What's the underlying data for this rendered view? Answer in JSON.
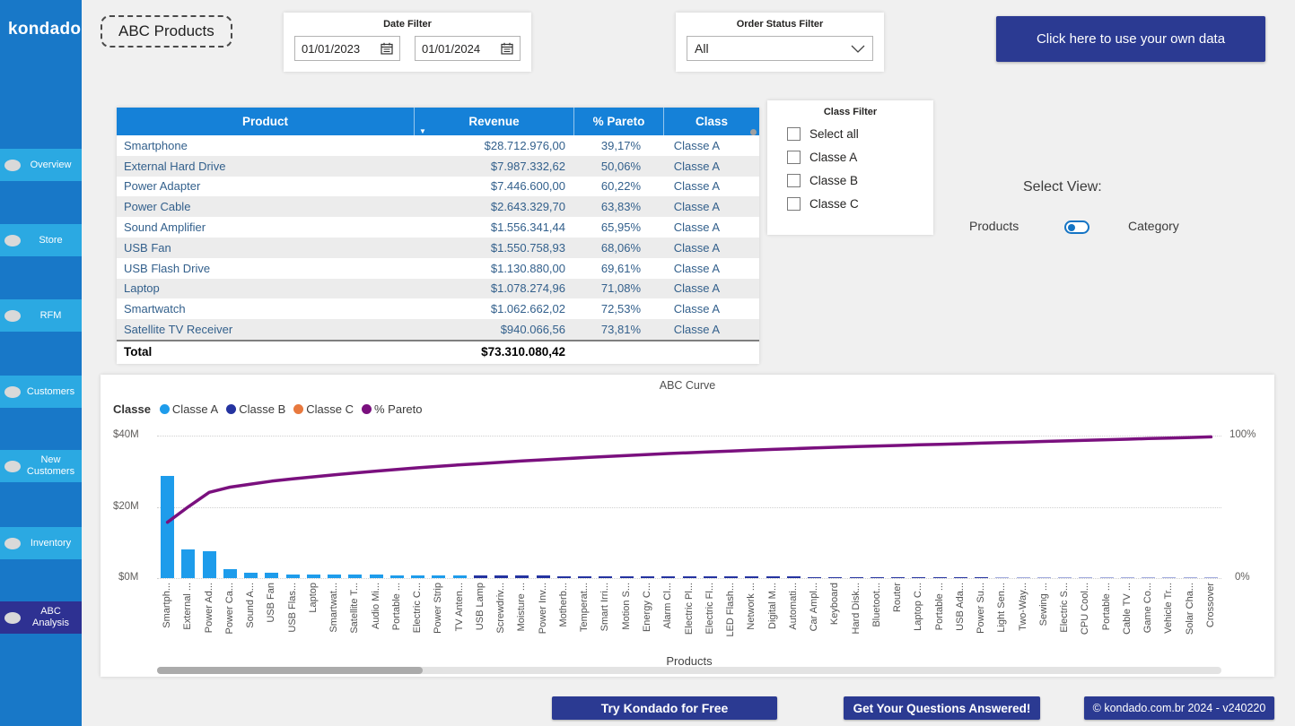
{
  "sidebar": {
    "logo": "kondado",
    "items": [
      {
        "label": "Overview",
        "active": false
      },
      {
        "label": "Store",
        "active": false
      },
      {
        "label": "RFM",
        "active": false
      },
      {
        "label": "Customers",
        "active": false
      },
      {
        "label": "New Customers",
        "active": false
      },
      {
        "label": "Inventory",
        "active": false
      },
      {
        "label": "ABC Analysis",
        "active": true
      }
    ]
  },
  "header": {
    "page_title": "ABC Products",
    "date_filter": {
      "title": "Date Filter",
      "start": "01/01/2023",
      "end": "01/01/2024"
    },
    "order_status_filter": {
      "title": "Order Status Filter",
      "value": "All"
    },
    "cta": "Click here to use your own data"
  },
  "table": {
    "columns": [
      "Product",
      "Revenue",
      "% Pareto",
      "Class"
    ],
    "rows": [
      [
        "Smartphone",
        "$28.712.976,00",
        "39,17%",
        "Classe A"
      ],
      [
        "External Hard Drive",
        "$7.987.332,62",
        "50,06%",
        "Classe A"
      ],
      [
        "Power Adapter",
        "$7.446.600,00",
        "60,22%",
        "Classe A"
      ],
      [
        "Power Cable",
        "$2.643.329,70",
        "63,83%",
        "Classe A"
      ],
      [
        "Sound Amplifier",
        "$1.556.341,44",
        "65,95%",
        "Classe A"
      ],
      [
        "USB Fan",
        "$1.550.758,93",
        "68,06%",
        "Classe A"
      ],
      [
        "USB Flash Drive",
        "$1.130.880,00",
        "69,61%",
        "Classe A"
      ],
      [
        "Laptop",
        "$1.078.274,96",
        "71,08%",
        "Classe A"
      ],
      [
        "Smartwatch",
        "$1.062.662,02",
        "72,53%",
        "Classe A"
      ],
      [
        "Satellite TV Receiver",
        "$940.066,56",
        "73,81%",
        "Classe A"
      ]
    ],
    "total_label": "Total",
    "total_value": "$73.310.080,42"
  },
  "class_filter": {
    "title": "Class Filter",
    "options": [
      "Select all",
      "Classe A",
      "Classe B",
      "Classe C"
    ],
    "checked": [
      false,
      false,
      false,
      false
    ]
  },
  "view_selector": {
    "title": "Select View:",
    "left": "Products",
    "right": "Category"
  },
  "chart_data": {
    "type": "bar",
    "subtype": "pareto",
    "title": "ABC Curve",
    "xlabel": "Products",
    "legend_title": "Classe",
    "legend": [
      {
        "label": "Classe A",
        "color": "#1E9CEB"
      },
      {
        "label": "Classe B",
        "color": "#2433A0"
      },
      {
        "label": "Classe C",
        "color": "#E8793E"
      },
      {
        "label": "% Pareto",
        "color": "#7A107E"
      }
    ],
    "left_axis": {
      "ticks": [
        "$40M",
        "$20M",
        "$0M"
      ],
      "range_millions": [
        0,
        40
      ]
    },
    "right_axis": {
      "ticks": [
        "100%",
        "0%"
      ],
      "range_pct": [
        0,
        100
      ]
    },
    "categories": [
      "Smartph...",
      "External ...",
      "Power Ad...",
      "Power Ca...",
      "Sound A...",
      "USB Fan",
      "USB Flas...",
      "Laptop",
      "Smartwat...",
      "Satellite T...",
      "Audio Mi...",
      "Portable ...",
      "Electric C...",
      "Power Strip",
      "TV Anten...",
      "USB Lamp",
      "Screwdriv...",
      "Moisture ...",
      "Power Inv...",
      "Motherb...",
      "Temperat...",
      "Smart Irri...",
      "Motion S...",
      "Energy C...",
      "Alarm Cl...",
      "Electric Pl...",
      "Electric Fl...",
      "LED Flash...",
      "Network ...",
      "Digital M...",
      "Automati...",
      "Car Ampl...",
      "Keyboard",
      "Hard Disk...",
      "Bluetoot...",
      "Router",
      "Laptop C...",
      "Portable ...",
      "USB Ada...",
      "Power Su...",
      "Light Sen...",
      "Two-Way...",
      "Sewing ...",
      "Electric S...",
      "CPU Cool...",
      "Portable ...",
      "Cable TV ...",
      "Game Co...",
      "Vehicle Tr...",
      "Solar Cha...",
      "Crossover"
    ],
    "bar_values_millions": [
      28.71,
      7.99,
      7.45,
      2.64,
      1.56,
      1.55,
      1.13,
      1.08,
      1.06,
      0.94,
      0.95,
      0.88,
      0.84,
      0.8,
      0.76,
      0.72,
      0.69,
      0.66,
      0.63,
      0.6,
      0.58,
      0.56,
      0.54,
      0.52,
      0.5,
      0.48,
      0.46,
      0.44,
      0.42,
      0.4,
      0.38,
      0.37,
      0.36,
      0.35,
      0.34,
      0.33,
      0.32,
      0.31,
      0.3,
      0.29,
      0.28,
      0.27,
      0.26,
      0.25,
      0.24,
      0.23,
      0.22,
      0.21,
      0.2,
      0.19,
      0.18
    ],
    "bar_class": [
      "A",
      "A",
      "A",
      "A",
      "A",
      "A",
      "A",
      "A",
      "A",
      "A",
      "A",
      "A",
      "A",
      "A",
      "A",
      "B",
      "B",
      "B",
      "B",
      "B",
      "B",
      "B",
      "B",
      "B",
      "B",
      "B",
      "B",
      "B",
      "B",
      "B",
      "B",
      "B",
      "B",
      "B",
      "B",
      "B",
      "B",
      "B",
      "B",
      "B",
      "C",
      "C",
      "C",
      "C",
      "C",
      "C",
      "C",
      "C",
      "C",
      "C",
      "C"
    ],
    "class_bar_colors": {
      "A": "#1E9CEB",
      "B": "#2433A0",
      "C": "#9FA8DC"
    },
    "pareto_cumulative_pct": [
      39.17,
      50.06,
      60.22,
      63.83,
      65.95,
      68.06,
      69.61,
      71.08,
      72.53,
      73.81,
      75.1,
      76.3,
      77.4,
      78.5,
      79.5,
      80.4,
      81.3,
      82.2,
      83.0,
      83.8,
      84.6,
      85.3,
      86.0,
      86.7,
      87.4,
      88.0,
      88.6,
      89.2,
      89.8,
      90.3,
      90.8,
      91.3,
      91.8,
      92.3,
      92.7,
      93.1,
      93.5,
      93.9,
      94.3,
      94.7,
      95.1,
      95.5,
      95.9,
      96.3,
      96.7,
      97.1,
      97.5,
      97.9,
      98.3,
      98.7,
      99.1
    ],
    "line_color": "#7A107E"
  },
  "footer": {
    "try_button": "Try Kondado for Free",
    "questions_button": "Get Your Questions Answered!",
    "copyright": "© kondado.com.br 2024 - v240220"
  }
}
